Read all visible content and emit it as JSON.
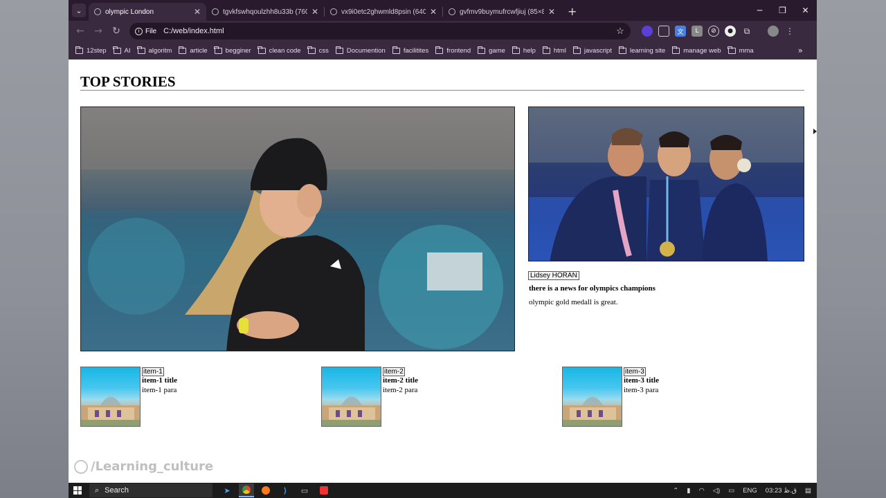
{
  "browser": {
    "tabs": [
      {
        "title": "olympic London",
        "active": true
      },
      {
        "title": "tgvkfswhqoulzhh8u33b (760×4",
        "active": false
      },
      {
        "title": "vx9i0etc2ghwmld8psin (640×3",
        "active": false
      },
      {
        "title": "gvfmv9buymufrcwfjiuj (85×85)",
        "active": false
      }
    ],
    "new_tab": "+",
    "address": {
      "chip": "File",
      "url": "C:/web/index.html"
    },
    "bookmarks": [
      "12step",
      "AI",
      "algoritm",
      "article",
      "begginer",
      "clean code",
      "css",
      "Documention",
      "facilitites",
      "frontend",
      "game",
      "help",
      "html",
      "javascript",
      "learning site",
      "manage web",
      "mma"
    ],
    "bookmarks_more": "»"
  },
  "page": {
    "heading": "TOP STORIES",
    "side_story": {
      "tag": "Lidsey HORAN",
      "title": "there is a news for olympics champions",
      "para": "olympic gold medall is great."
    },
    "items": [
      {
        "tag": "item-1",
        "title": "item-1 title",
        "para": "item-1 para"
      },
      {
        "tag": "item-2",
        "title": "item-2 title",
        "para": "item-2 para"
      },
      {
        "tag": "item-3",
        "title": "item-3 title",
        "para": "item-3 para"
      }
    ],
    "watermark": "/Learning_culture"
  },
  "taskbar": {
    "search_label": "Search",
    "lang": "ENG",
    "time": "03:23 ق.ظ"
  }
}
